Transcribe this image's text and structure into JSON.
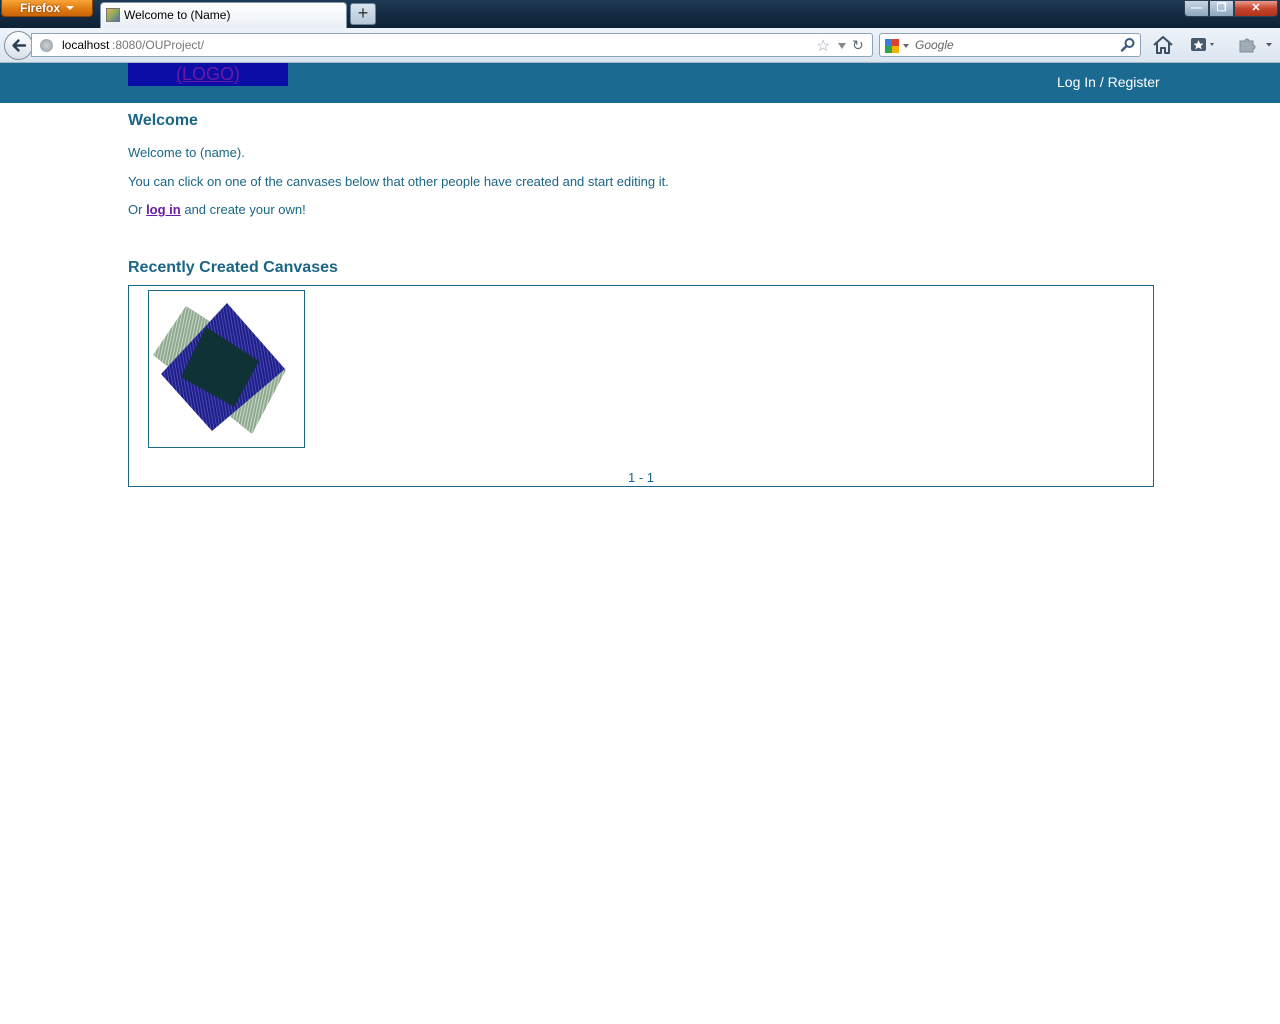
{
  "browser": {
    "app_menu_label": "Firefox",
    "tab_title": "Welcome to (Name)",
    "new_tab_label": "+",
    "url_host": "localhost",
    "url_path": ":8080/OUProject/",
    "search_placeholder": "Google"
  },
  "site": {
    "logo_text": "(LOGO)",
    "login_register_label": "Log In / Register"
  },
  "main": {
    "welcome_heading": "Welcome",
    "welcome_text": "Welcome to (name).",
    "instructions_text": "You can click on one of the canvases below that other people have created and start editing it.",
    "or_text": "Or ",
    "login_link_label": "log in",
    "create_text": " and create your own!",
    "recent_heading": "Recently Created Canvases",
    "pagination": "1 - 1"
  },
  "colors": {
    "header_bg": "#1a6a92",
    "text": "#1b6585",
    "logo_bg": "#0c0ca6",
    "link": "#6b1aa3"
  }
}
